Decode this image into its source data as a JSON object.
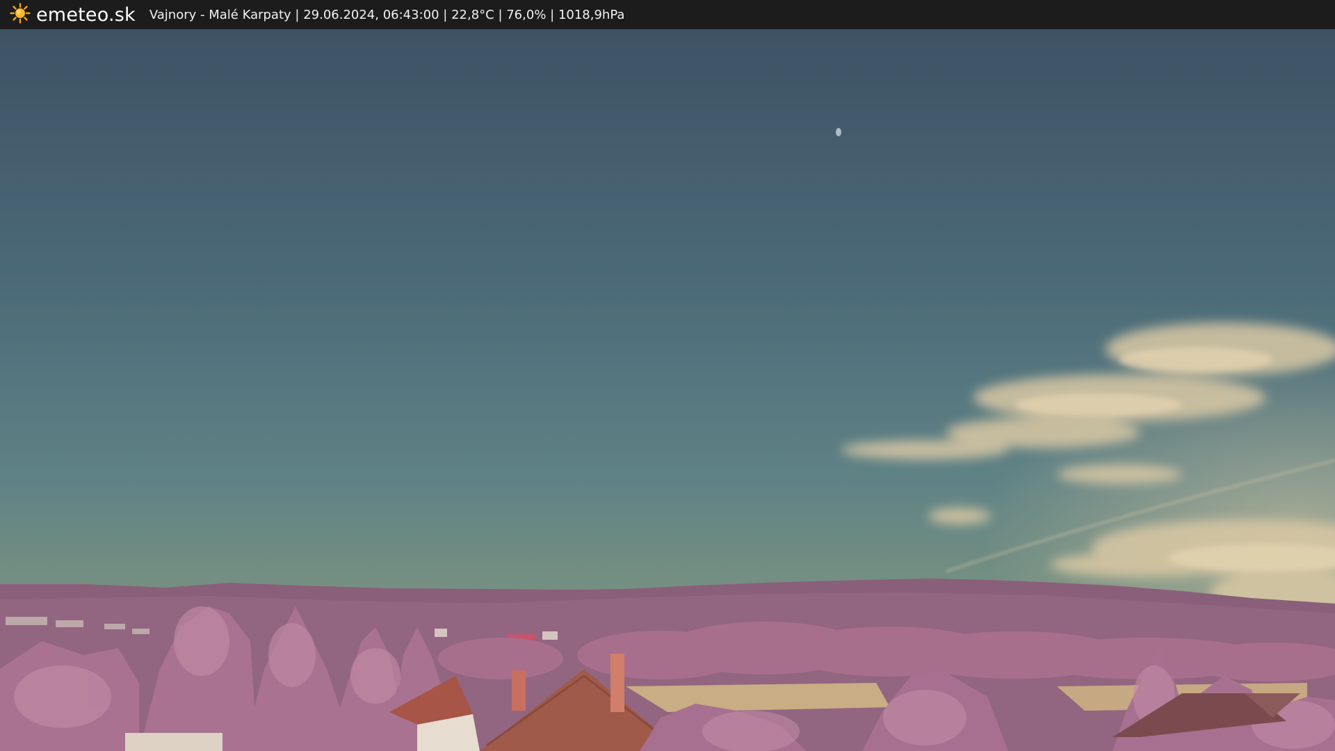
{
  "header": {
    "logo_icon": "sun-icon",
    "brand": "emeteo.sk",
    "location": "Vajnory - Malé Karpaty",
    "datetime": "29.06.2024, 06:43:00",
    "temperature": "22,8°C",
    "humidity": "76,0%",
    "pressure": "1018,9hPa",
    "separator": " | "
  },
  "colors": {
    "bar_background": "#1c1c1c",
    "sky_top": "#3f5566",
    "sky_horizon": "#7a917f",
    "cloud": "#d8c7a3",
    "hills": "#8a5f7a",
    "trees": "#b07890",
    "field": "#c9ad84",
    "roof": "#a05a4a"
  }
}
